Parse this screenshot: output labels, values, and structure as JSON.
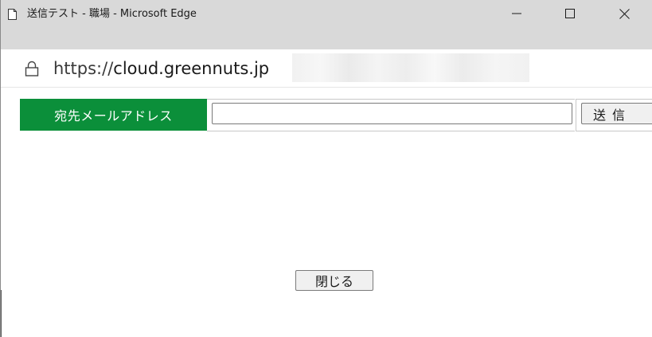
{
  "window": {
    "title": "送信テスト - 職場 - Microsoft Edge",
    "minimize_label": "—",
    "maximize_label": "☐",
    "close_label": "✕",
    "page_icon": "page-icon"
  },
  "address_bar": {
    "lock_icon": "lock-icon",
    "url_scheme": "https://",
    "url_host": "cloud.greennuts.jp"
  },
  "form": {
    "email_label": "宛先メールアドレス",
    "email_value": "",
    "send_label": "送信"
  },
  "footer": {
    "close_label": "閉じる"
  },
  "colors": {
    "label_bg": "#0b8f3a",
    "titlebar_bg": "#d9d9d9"
  }
}
